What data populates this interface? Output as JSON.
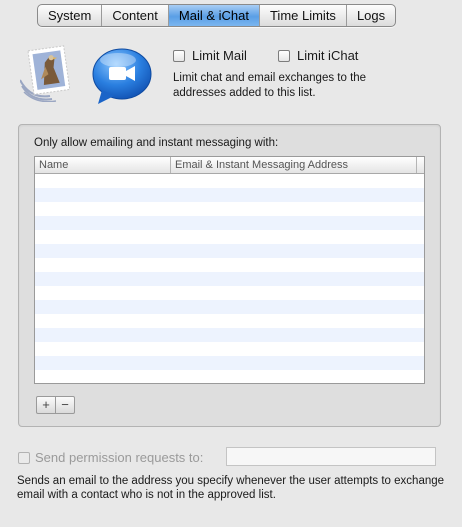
{
  "tabs": [
    {
      "label": "System"
    },
    {
      "label": "Content"
    },
    {
      "label": "Mail & iChat",
      "active": true
    },
    {
      "label": "Time Limits"
    },
    {
      "label": "Logs"
    }
  ],
  "limits": {
    "limit_mail_label": "Limit Mail",
    "limit_mail_checked": false,
    "limit_ichat_label": "Limit iChat",
    "limit_ichat_checked": false,
    "description": "Limit chat and email exchanges to the addresses added to this list."
  },
  "allowlist": {
    "title": "Only allow emailing and instant messaging with:",
    "columns": [
      "Name",
      "Email & Instant Messaging Address"
    ],
    "rows": [],
    "add_label": "+",
    "remove_label": "−"
  },
  "permission": {
    "label": "Send permission requests to:",
    "checked": false,
    "enabled": false,
    "address_value": "",
    "description": "Sends an email to the address you specify whenever the user attempts to exchange email with a contact who is not in the approved list."
  },
  "icons": {
    "mail": "mail-stamp-icon",
    "ichat": "ichat-video-icon"
  },
  "colors": {
    "selected_tab": "#5a9fe6",
    "table_alt_row": "#edf3fe",
    "window_bg": "#e8e8e8"
  }
}
